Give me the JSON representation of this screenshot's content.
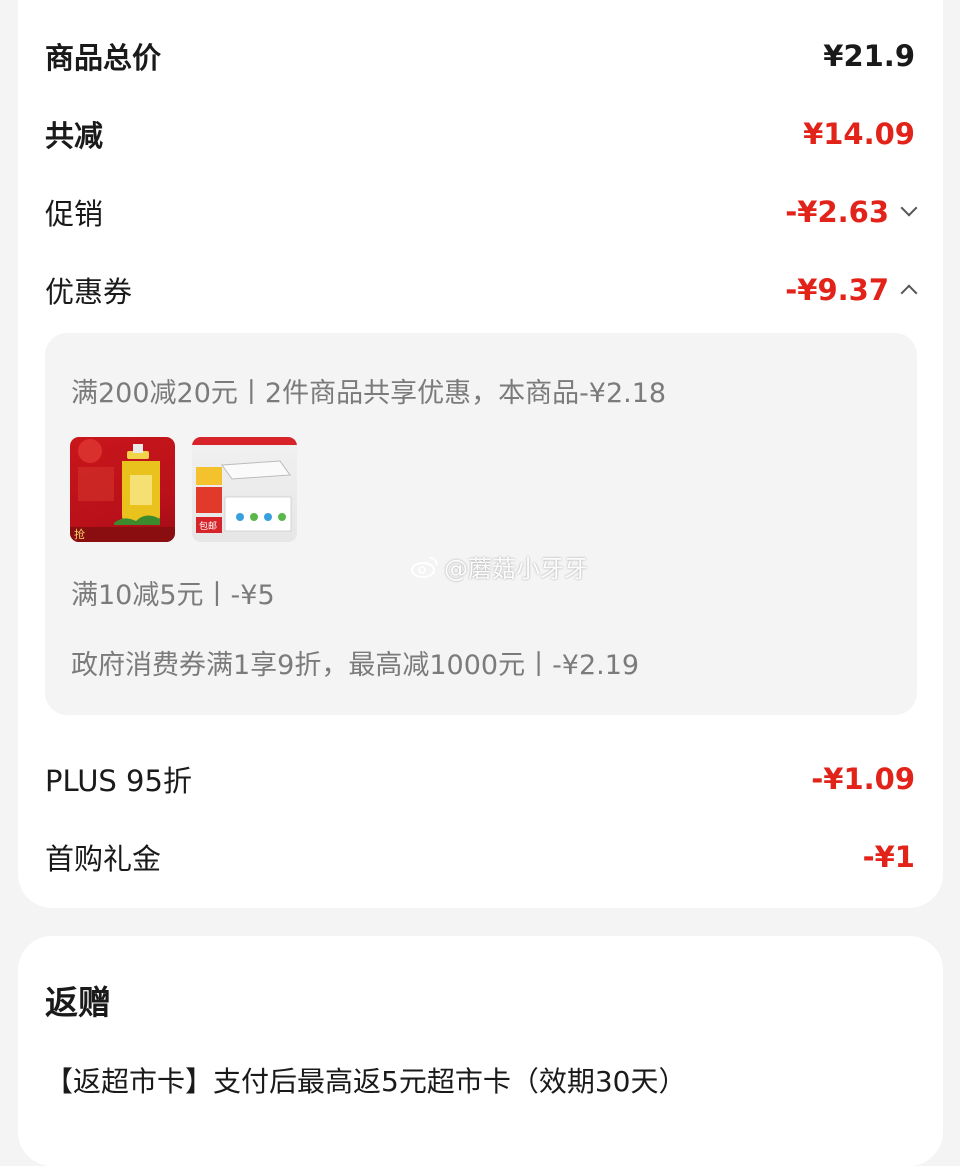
{
  "summary": {
    "total": {
      "label": "商品总价",
      "value": "¥21.9"
    },
    "reduce": {
      "label": "共减",
      "value": "¥14.09"
    },
    "promo": {
      "label": "促销",
      "value": "-¥2.63"
    },
    "coupon": {
      "label": "优惠券",
      "value": "-¥9.37"
    },
    "plus": {
      "label": "PLUS 95折",
      "value": "-¥1.09"
    },
    "first": {
      "label": "首购礼金",
      "value": "-¥1"
    }
  },
  "coupon_details": {
    "line1": "满200减20元丨2件商品共享优惠，本商品-¥2.18",
    "line2": "满10减5元丨-¥5",
    "line3": "政府消费券满1享9折，最高减1000元丨-¥2.19",
    "products": [
      {
        "name": "hand-soap-product",
        "text": "抢"
      },
      {
        "name": "ceiling-light-product",
        "text": "包邮"
      }
    ]
  },
  "gift": {
    "title": "返赠",
    "text": "【返超市卡】支付后最高返5元超市卡（效期30天）"
  },
  "watermark": "@蘑菇小牙牙",
  "colors": {
    "accent": "#e2231a",
    "muted": "#7b7b7b",
    "bg": "#f4f4f4"
  }
}
